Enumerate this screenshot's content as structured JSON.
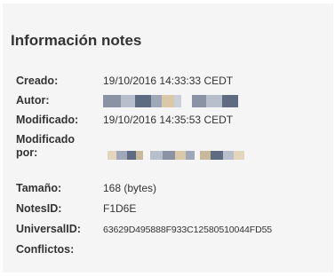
{
  "panel": {
    "title": "Información notes",
    "fields": [
      {
        "label": "Creado:",
        "value": "19/10/2016 14:33:33 CEDT"
      },
      {
        "label": "Autor:",
        "value": ""
      },
      {
        "label": "Modificado:",
        "value": "19/10/2016 14:35:53 CEDT"
      },
      {
        "label": "Modificado por:",
        "value": ""
      },
      {
        "label": "Tamaño:",
        "value": "168 (bytes)"
      },
      {
        "label": "NotesID:",
        "value": "F1D6E"
      },
      {
        "label": "UniversalID:",
        "value": "63629D495888F933C12580510044FD55"
      },
      {
        "label": "Conflictos:",
        "value": ""
      }
    ]
  },
  "colors": {
    "panel_background": "#f5f5f5",
    "text": "#333333",
    "redaction": [
      "#8a93a3",
      "#b8bfcc",
      "#5f6b80",
      "#c9b89a",
      "#d9c9a8",
      "#9fa8b8"
    ]
  }
}
